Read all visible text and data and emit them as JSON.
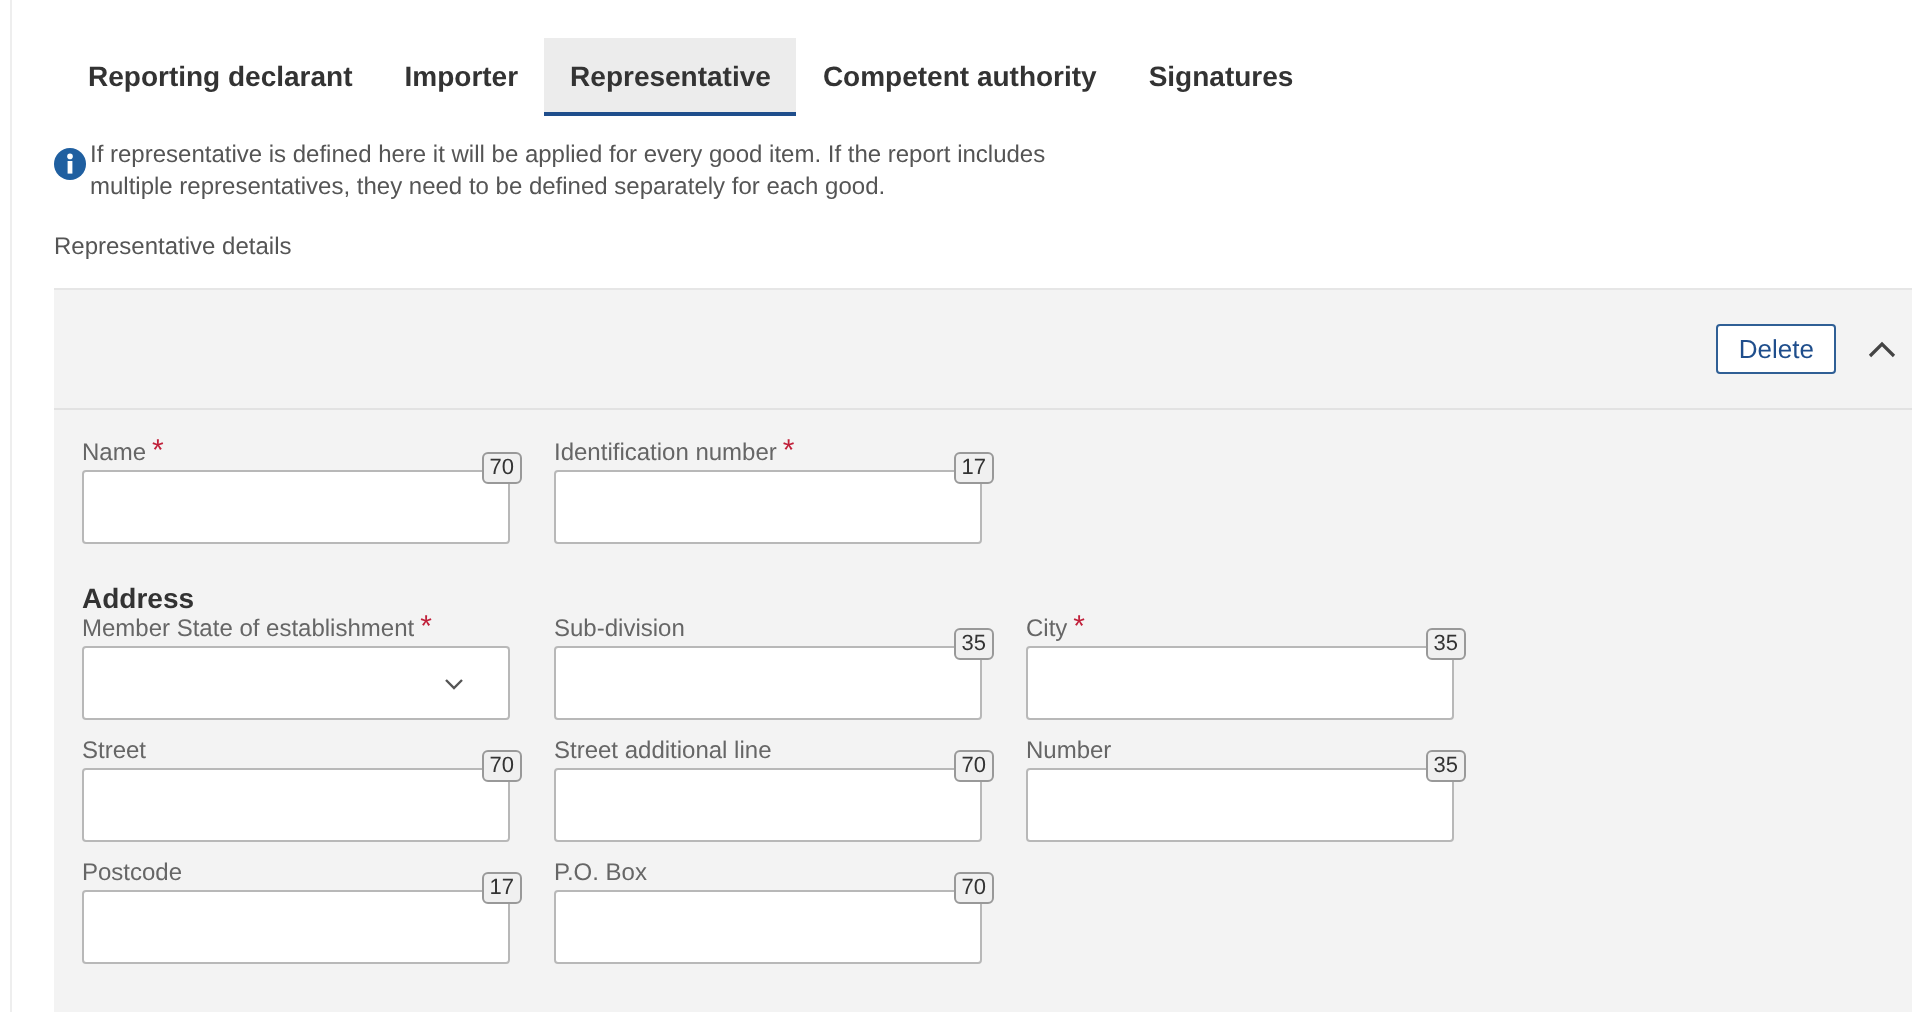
{
  "tabs": [
    {
      "label": "Reporting declarant",
      "selected": false
    },
    {
      "label": "Importer",
      "selected": false
    },
    {
      "label": "Representative",
      "selected": true
    },
    {
      "label": "Competent authority",
      "selected": false
    },
    {
      "label": "Signatures",
      "selected": false
    }
  ],
  "info": "If representative is defined here it will be applied for every good item. If the report includes multiple representatives, they need to be defined separately for each good.",
  "section_label": "Representative details",
  "panel": {
    "delete_button": "Delete",
    "expanded": true,
    "fields": [
      {
        "kind": "text",
        "label": "Name",
        "required_mark": "*",
        "counter": "70"
      },
      {
        "kind": "text",
        "label": "Identification number",
        "required_mark": "*",
        "counter": "17"
      }
    ],
    "address": {
      "heading": "Address",
      "fields": [
        {
          "kind": "select",
          "label": "Member State of establishment",
          "required_mark": "*"
        },
        {
          "kind": "text",
          "label": "Sub-division",
          "counter": "35"
        },
        {
          "kind": "text",
          "label": "City",
          "required_mark": "*",
          "counter": "35"
        },
        {
          "kind": "text",
          "label": "Street",
          "counter": "70"
        },
        {
          "kind": "text",
          "label": "Street additional line",
          "counter": "70"
        },
        {
          "kind": "text",
          "label": "Number",
          "counter": "35"
        },
        {
          "kind": "text",
          "label": "Postcode",
          "counter": "17"
        },
        {
          "kind": "text",
          "label": "P.O. Box",
          "counter": "70"
        }
      ]
    }
  }
}
